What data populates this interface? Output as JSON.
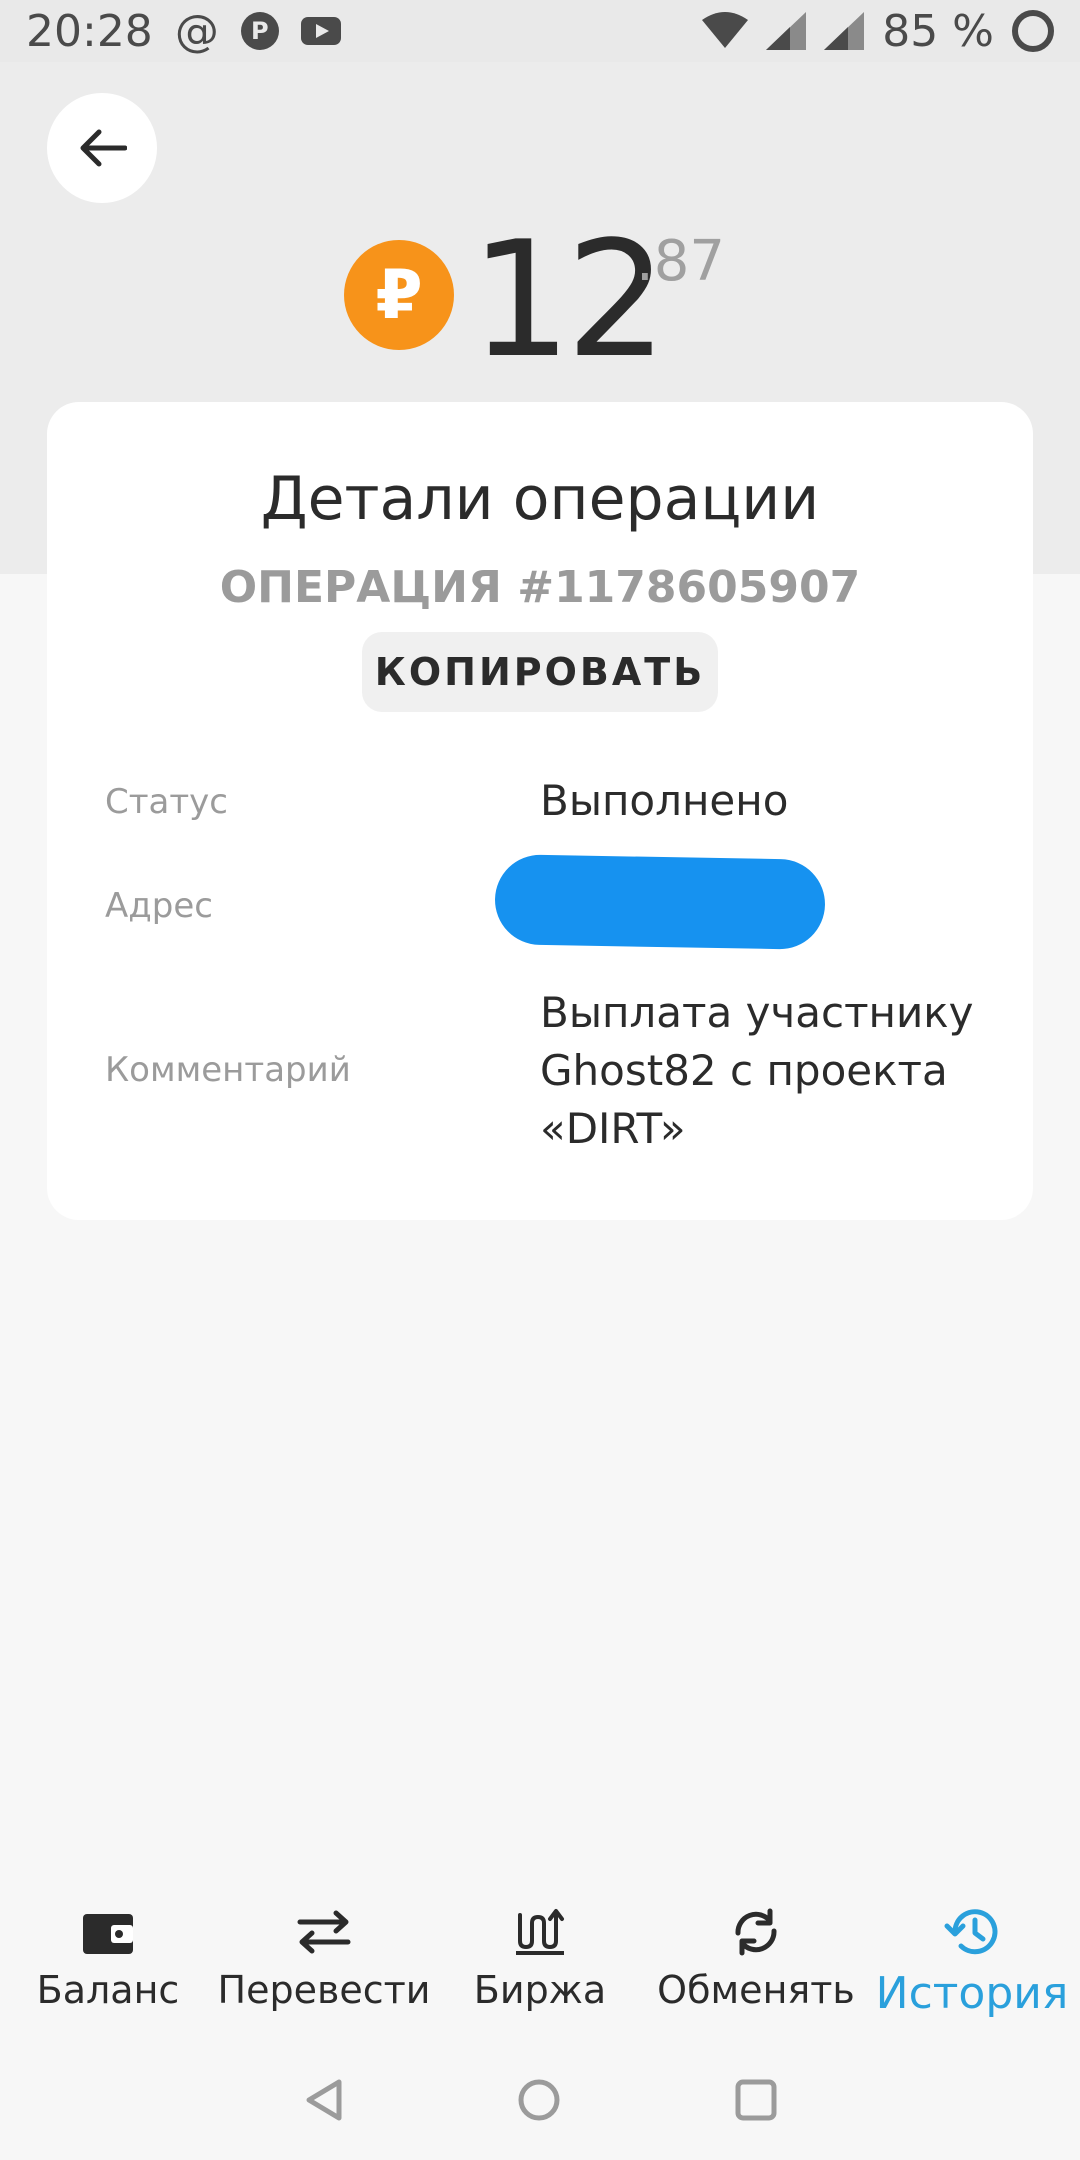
{
  "status_bar": {
    "time": "20:28",
    "at_symbol": "@",
    "p_badge": "P",
    "battery": "85 %"
  },
  "balance": {
    "integer": "12",
    "fraction": ".87",
    "currency_symbol": "₽",
    "coin_color": "#f7931a"
  },
  "card": {
    "title": "Детали операции",
    "operation_number": "ОПЕРАЦИЯ #1178605907",
    "copy_label": "КОПИРОВАТЬ",
    "rows": [
      {
        "label": "Статус",
        "value": "Выполнено"
      },
      {
        "label": "Адрес",
        "value": ""
      },
      {
        "label": "Комментарий",
        "value": "Выплата участнику Ghost82 с проекта «DIRT»"
      }
    ],
    "redaction_color": "#1692f0"
  },
  "nav": {
    "active_color": "#2aa0dc",
    "items": [
      {
        "label": "Баланс",
        "icon": "wallet-icon"
      },
      {
        "label": "Перевести",
        "icon": "transfer-arrows-icon"
      },
      {
        "label": "Биржа",
        "icon": "exchange-chart-icon"
      },
      {
        "label": "Обменять",
        "icon": "swap-cycle-icon"
      },
      {
        "label": "История",
        "icon": "history-clock-icon"
      }
    ]
  }
}
